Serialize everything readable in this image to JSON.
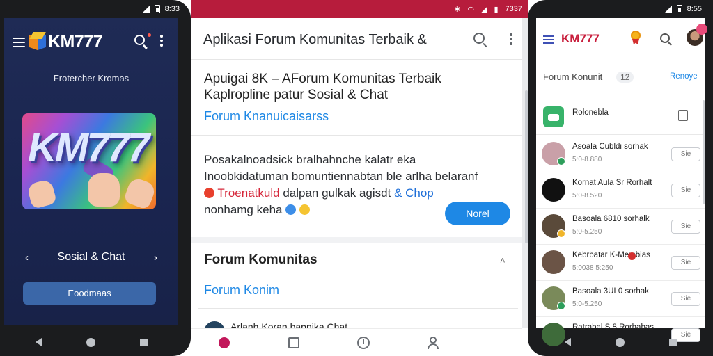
{
  "left_phone": {
    "status_time": "8:33",
    "brand": "KM777",
    "subtitle": "Frotercher Kromas",
    "banner_text": "KM777",
    "carousel_label": "Sosial & Chat",
    "carousel_prev": "‹",
    "carousel_next": "›",
    "button_label": "Eoodmaas"
  },
  "middle_screen": {
    "status_time": "7337",
    "title": "Aplikasi Forum Komunitas Terbaik &",
    "card1": {
      "heading": "Apuigai 8K – AForum Komunitas Terbaik Kaplropline patur Sosial & Chat",
      "link": "Forum Knanuicaisarss"
    },
    "card2": {
      "line1": "Posakalnoadsick bralhahnche kalatr eka",
      "line2": "Inoobkidatuman bomuntiennabtan ble arlha belaranf",
      "line3_red": "Troenatkuld",
      "line3_mid": "dalpan gulkak agisdt",
      "line3_blue": "& Chop",
      "line4": "nonhamg keha",
      "button_label": "Norel"
    },
    "card3": {
      "heading": "Forum Komunitas",
      "link": "Forum Konim",
      "caret": "˄"
    },
    "peek_text": "Arlanh Koran bapnika Chat"
  },
  "right_phone": {
    "status_time": "8:55",
    "brand": "KM777",
    "search_label": "Forum Konunit",
    "search_count": "12",
    "search_action": "Renoye",
    "first_item_label": "Rolonebla",
    "rows": [
      {
        "name": "Asoala Cubldi sorhak",
        "meta": "5:0-8.880",
        "button": "Sie",
        "avatar_color": "#c9a0a8",
        "badge_color": "#2e9e5b"
      },
      {
        "name": "Kornat Aula Sr Rorhalt",
        "meta": "5:0-8.520",
        "button": "Sie",
        "avatar_color": "#111111",
        "badge_color": ""
      },
      {
        "name": "Basoala 6810 sorhalk",
        "meta": "5:0-5.250",
        "button": "Sie",
        "avatar_color": "#5a4a3a",
        "badge_color": "#f0b52a"
      },
      {
        "name": "Kebrbatar K-Membias",
        "meta": "5:0038 5:250",
        "button": "Sie",
        "avatar_color": "#6b5446",
        "badge_color": "",
        "meta_badge": "#d32f2f"
      },
      {
        "name": "Basoala 3UL0 sorhak",
        "meta": "5:0-5.250",
        "button": "Sie",
        "avatar_color": "#7a8a5a",
        "badge_color": "#2e9e5b"
      },
      {
        "name": "Ratrabal S 8 Rorhabas",
        "meta": "",
        "button": "Sie",
        "avatar_color": "#3e6b3a",
        "badge_color": ""
      }
    ]
  }
}
